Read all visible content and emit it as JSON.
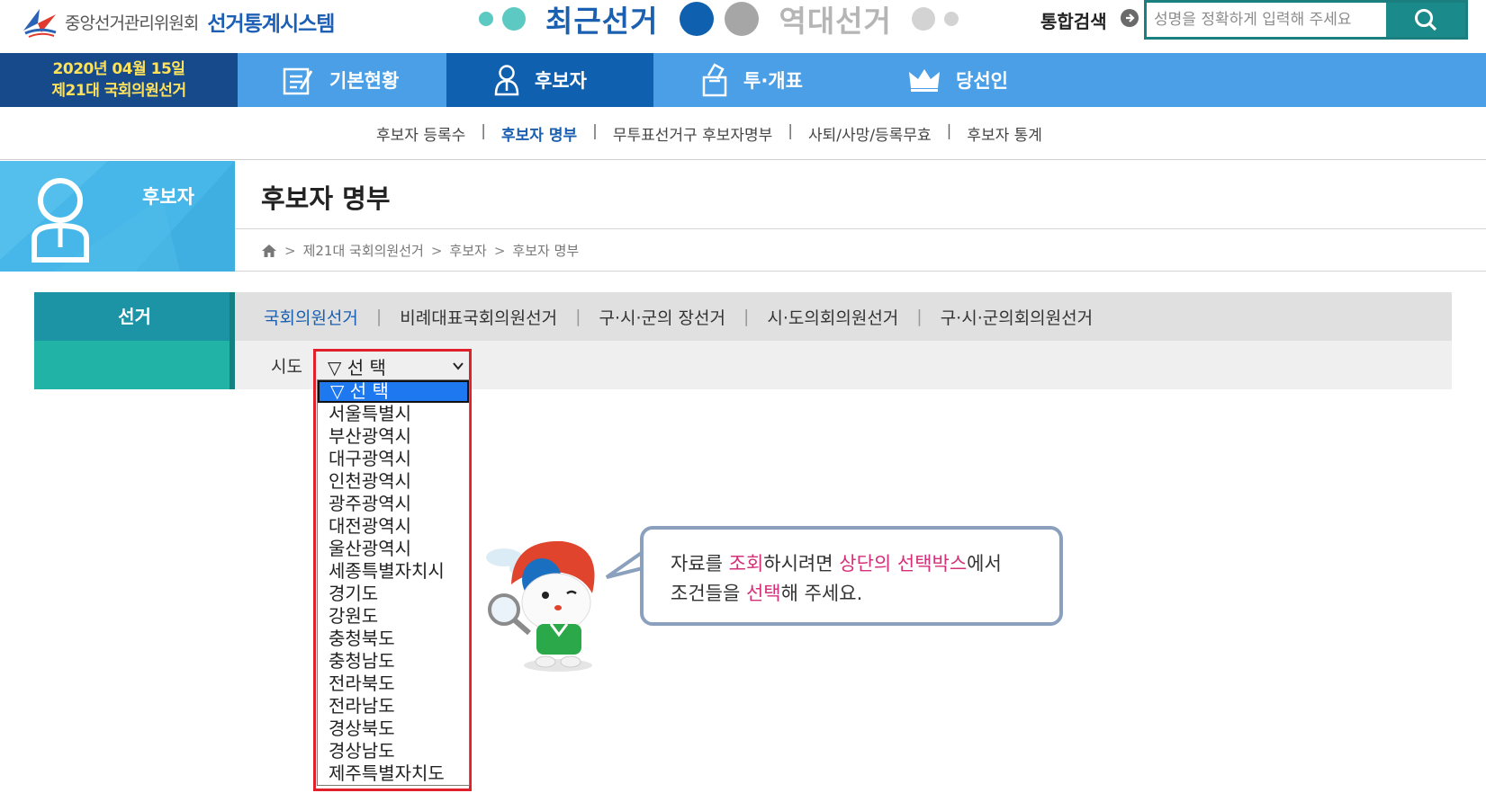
{
  "header": {
    "org_name": "중앙선거관리위원회",
    "system_name": "선거통계시스템",
    "recent_label": "최근선거",
    "past_label": "역대선거",
    "search_label": "통합검색",
    "search_placeholder": "성명을 정확하게 입력해 주세요"
  },
  "election": {
    "date": "2020년 04월 15일",
    "name": "제21대 국회의원선거"
  },
  "mainnav": {
    "items": [
      {
        "label": "기본현황",
        "icon": "clipboard-icon"
      },
      {
        "label": "후보자",
        "icon": "person-icon"
      },
      {
        "label": "투·개표",
        "icon": "ballot-box-icon"
      },
      {
        "label": "당선인",
        "icon": "crown-icon"
      }
    ],
    "active": "후보자"
  },
  "subnav": {
    "items": [
      "후보자 등록수",
      "후보자 명부",
      "무투표선거구 후보자명부",
      "사퇴/사망/등록무효",
      "후보자 통계"
    ],
    "active": "후보자 명부"
  },
  "page": {
    "section": "후보자",
    "title": "후보자 명부",
    "breadcrumb": [
      "제21대 국회의원선거",
      "후보자",
      "후보자 명부"
    ]
  },
  "filter": {
    "election_label": "선거",
    "election_types": [
      "국회의원선거",
      "비례대표국회의원선거",
      "구·시·군의 장선거",
      "시·도의회의원선거",
      "구·시·군의회의원선거"
    ],
    "active_type": "국회의원선거",
    "sido_label": "시도",
    "sido_selected": "▽ 선 택",
    "sido_options": [
      "▽ 선 택",
      "서울특별시",
      "부산광역시",
      "대구광역시",
      "인천광역시",
      "광주광역시",
      "대전광역시",
      "울산광역시",
      "세종특별자치시",
      "경기도",
      "강원도",
      "충청북도",
      "충청남도",
      "전라북도",
      "전라남도",
      "경상북도",
      "경상남도",
      "제주특별자치도"
    ]
  },
  "notice": {
    "p1": "자료를 ",
    "h1": "조회",
    "p2": "하시려면 ",
    "h2": "상단의 선택박스",
    "p3": "에서",
    "p4": "조건들을 ",
    "h3": "선택",
    "p5": "해 주세요."
  },
  "colors": {
    "nav_blue": "#4a9fe6",
    "nav_active": "#1060b0",
    "teal": "#1b8a8b",
    "highlight_red": "#e0202a",
    "notice_pink": "#d4307a"
  }
}
